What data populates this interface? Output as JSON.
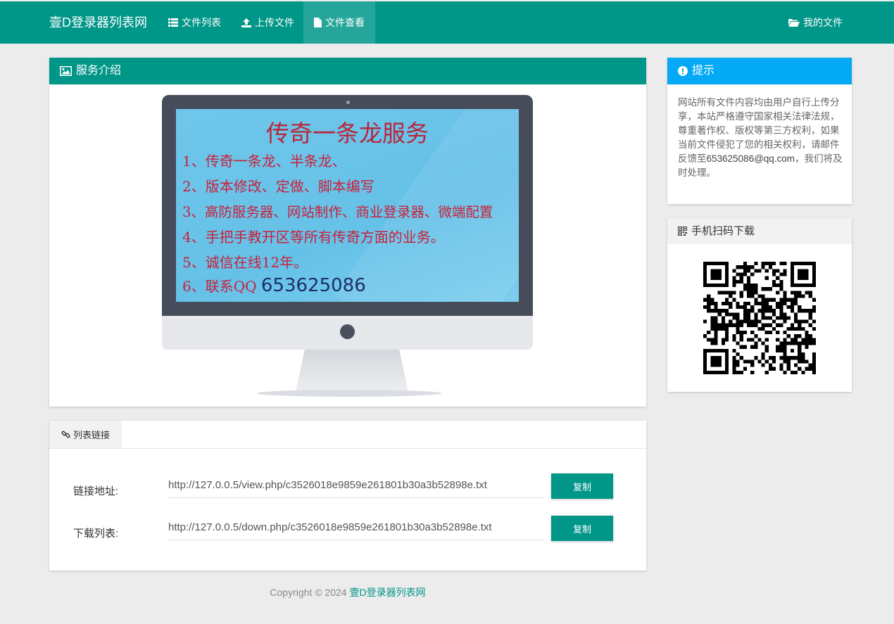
{
  "nav": {
    "brand": "壹D登录器列表网",
    "items": [
      {
        "label": "文件列表",
        "icon": "list-icon"
      },
      {
        "label": "上传文件",
        "icon": "upload-icon"
      },
      {
        "label": "文件查看",
        "icon": "file-icon",
        "active": true
      }
    ],
    "my_files": "我的文件"
  },
  "service": {
    "title": "服务介绍",
    "screen_title": "传奇一条龙服务",
    "lines": [
      "1、传奇一条龙、半条龙、",
      "2、版本修改、定做、脚本编写",
      "3、高防服务器、网站制作、商业登录器、微端配置",
      "4、手把手教开区等所有传奇方面的业务。",
      "5、诚信在线12年。"
    ],
    "contact_prefix": "6、联系QQ ",
    "contact_qq": "653625086"
  },
  "links": {
    "tab": "列表链接",
    "view_label": "链接地址:",
    "view_url": "http://127.0.0.5/view.php/c3526018e9859e261801b30a3b52898e.txt",
    "down_label": "下载列表:",
    "down_url": "http://127.0.0.5/down.php/c3526018e9859e261801b30a3b52898e.txt",
    "copy_label": "复制"
  },
  "notice": {
    "title": "提示",
    "text_before": "网站所有文件内容均由用户自行上传分享，本站严格遵守国家相关法律法规，尊重著作权、版权等第三方权利，如果当前文件侵犯了您的相关权利，请邮件反馈至",
    "email": "653625086@qq.com",
    "text_after": "，我们将及时处理。"
  },
  "qr": {
    "title": "手机扫码下载"
  },
  "footer": {
    "copyright": "Copyright © 2024 ",
    "site": "壹D登录器列表网"
  },
  "colors": {
    "primary": "#009688",
    "info": "#03a9f4",
    "background": "#ececec"
  }
}
